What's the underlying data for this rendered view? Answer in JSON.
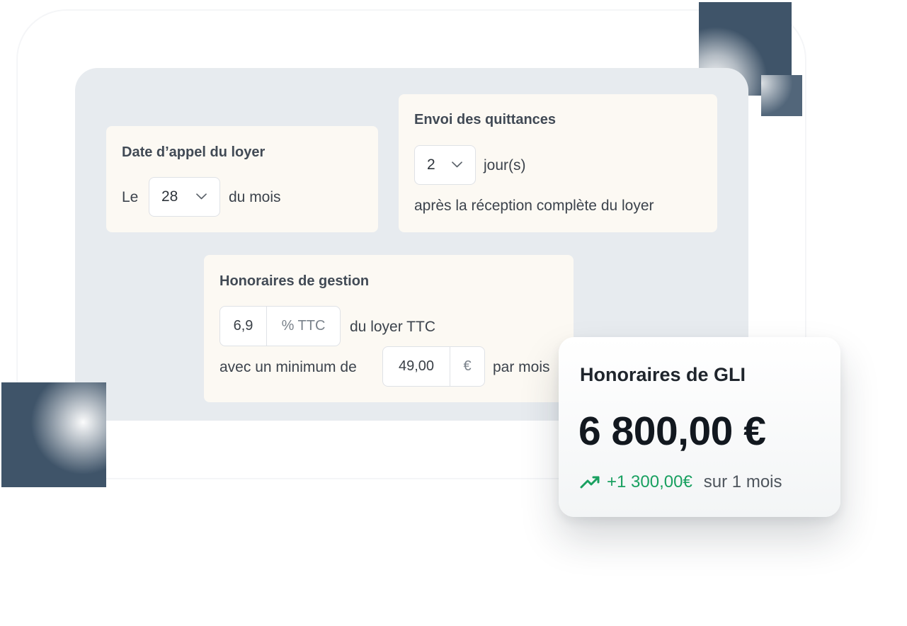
{
  "date_appel": {
    "title": "Date d’appel du loyer",
    "prefix": "Le",
    "day_value": "28",
    "suffix": "du mois"
  },
  "quittances": {
    "title": "Envoi des quittances",
    "days_value": "2",
    "unit": "jour(s)",
    "description": "après la réception complète du loyer"
  },
  "honoraires_gestion": {
    "title": "Honoraires de gestion",
    "rate_value": "6,9",
    "rate_unit": "% TTC",
    "rate_suffix": "du loyer TTC",
    "min_prefix": "avec un minimum de",
    "min_value": "49,00",
    "min_unit": "€",
    "min_suffix": "par mois"
  },
  "gli": {
    "title": "Honoraires de GLI",
    "amount": "6 800,00 €",
    "delta": "+1 300,00€",
    "period": "sur 1 mois",
    "trend_icon": "trending-up-icon",
    "trend_color": "#19a060"
  },
  "colors": {
    "panel": "#e7ebef",
    "card": "#fcf9f3",
    "deco": "#3f5469"
  }
}
